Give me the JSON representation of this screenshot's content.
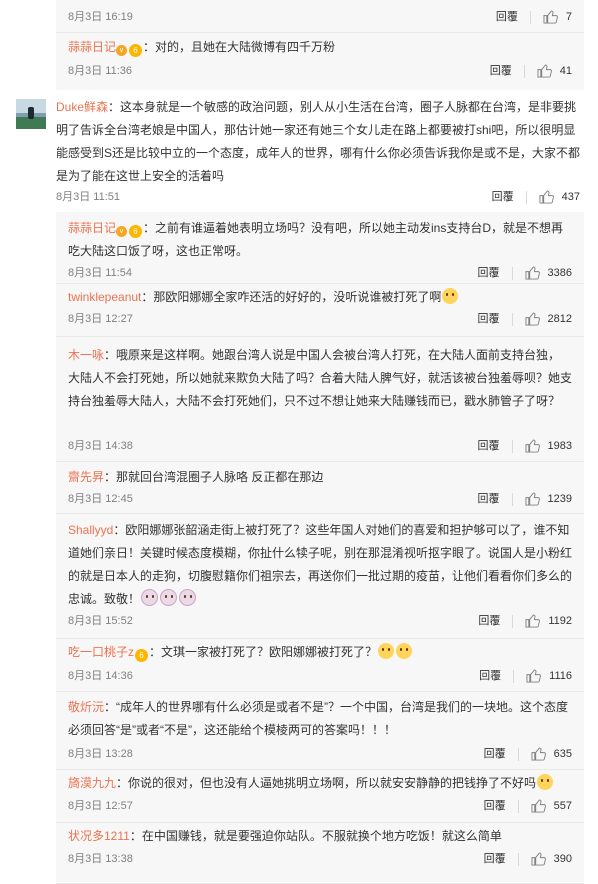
{
  "labels": {
    "reply": "回覆"
  },
  "top_replies": [
    {
      "date": "8月3日 16:19",
      "likes": "7"
    },
    {
      "user": "蒜蒜日记",
      "text": "：对的，且她在大陆微博有四千万粉",
      "date": "8月3日 11:36",
      "likes": "41"
    }
  ],
  "main_comment": {
    "user": "Duke鲜森",
    "text": "：这本身就是一个敏感的政治问题，别人从小生活在台湾，圈子人脉都在台湾，是非要挑明了告诉全台湾老娘是中国人，那估计她一家还有她三个女儿走在路上都要被打shi吧，所以很明显能感受到S还是比较中立的一个态度，成年人的世界，哪有什么你必须告诉我你是或不是，大家不都是为了能在这世上安全的活着吗",
    "date": "8月3日 11:51",
    "likes": "437"
  },
  "replies": [
    {
      "user": "蒜蒜日记",
      "text": "：之前有谁逼着她表明立场吗？没有吧，所以她主动发ins支持台D，就是不想再吃大陆这口饭了呀，这也正常呀。",
      "date": "8月3日 11:54",
      "likes": "3386"
    },
    {
      "user": "twinklepeanut",
      "text": "：那欧阳娜娜全家咋还活的好好的，没听说谁被打死了啊",
      "date": "8月3日 12:27",
      "likes": "2812"
    },
    {
      "user": "木一咏",
      "text": "：哦原来是这样啊。她跟台湾人说是中国人会被台湾人打死，在大陆人面前支持台独，大陆人不会打死她，所以她就来欺负大陆了吗？合着大陆人脾气好，就活该被台独羞辱呗？她支持台独羞辱大陆人，大陆不会打死她们，只不过不想让她来大陆赚钱而已，戳水肺管子了呀？",
      "date": "8月3日 14:38",
      "likes": "1983"
    },
    {
      "user": "齋先昇",
      "text": "：那就回台湾混圈子人脉咯 反正都在那边",
      "date": "8月3日 12:45",
      "likes": "1239"
    },
    {
      "user": "Shallyyd",
      "text": "：欧阳娜娜张韶涵走街上被打死了？这些年国人对她们的喜爱和担护够可以了，谁不知道她们亲日！关键时候态度模糊，你扯什么犊子呢，别在那混淆视听抠字眼了。说国人是小粉红的就是日本人的走狗，切腹慰籍你们祖宗去，再送你们一批过期的疫苗，让他们看看你们多么的忠诚。致敬！",
      "date": "8月3日 15:52",
      "likes": "1192"
    },
    {
      "user": "吃一口桃子z",
      "text": "：文琪一家被打死了？欧阳娜娜被打死了？",
      "date": "8月3日 14:36",
      "likes": "1116"
    },
    {
      "user": "敬炘沅",
      "text": "：“成年人的世界哪有什么必须是或者不是”？一个中国，台湾是我们的一块地。这个态度必须回答“是”或者“不是”，这还能给个模棱两可的答案吗！！！",
      "date": "8月3日 13:28",
      "likes": "635"
    },
    {
      "user": "旖漠九九",
      "text": "：你说的很对，但也没有人逼她挑明立场啊，所以就安安静静的把钱挣了不好吗",
      "date": "8月3日 12:57",
      "likes": "557"
    },
    {
      "user": "状况多1211",
      "text": "：在中国赚钱，就是要强迫你站队。不服就换个地方吃饭！就这么简单",
      "date": "8月3日 13:38",
      "likes": "390"
    }
  ]
}
